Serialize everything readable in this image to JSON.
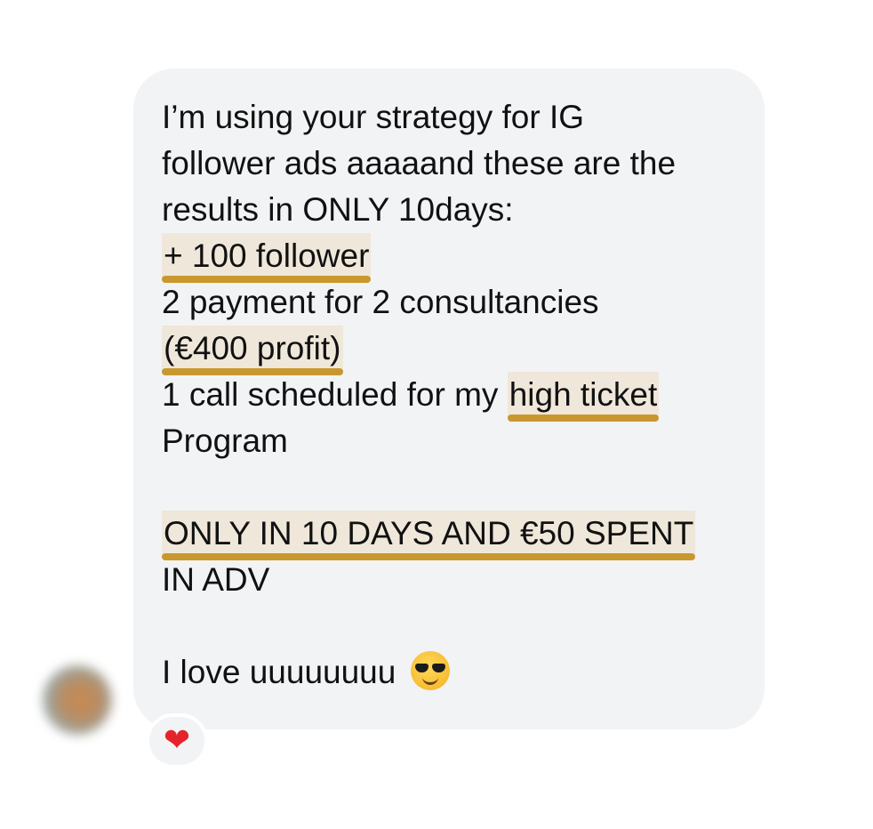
{
  "message": {
    "lines": [
      "I’m using your strategy for IG",
      "follower ads aaaaand these are the",
      "results in ONLY 10days:",
      "+ 100 follower",
      "2 payment for 2 consultancies",
      "(€400 profit)",
      "1 call scheduled for my ",
      "high ticket",
      "Program",
      "ONLY IN 10 DAYS AND €50 SPENT",
      "IN ADV",
      "I love uuuuuuuu "
    ],
    "emoji": "smiling-face-with-sunglasses"
  },
  "reaction": {
    "symbol": "❤",
    "icon": "heart-icon",
    "color": "#e3242b"
  },
  "colors": {
    "bubble": "#f2f3f5",
    "highlight_fill": "#efe7da",
    "underline": "#c8982e"
  }
}
